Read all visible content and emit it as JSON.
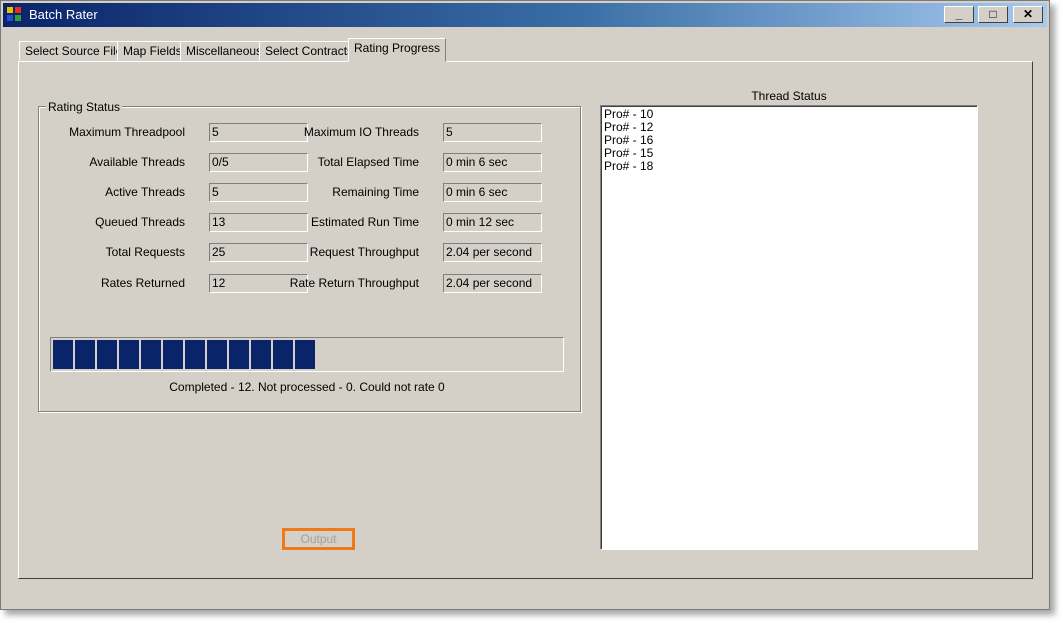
{
  "window": {
    "title": "Batch Rater",
    "minimize": "_",
    "maximize": "□",
    "close": "✕"
  },
  "tabs": [
    {
      "label": "Select Source File"
    },
    {
      "label": "Map Fields"
    },
    {
      "label": "Miscellaneous"
    },
    {
      "label": "Select Contracts"
    },
    {
      "label": "Rating Progress"
    }
  ],
  "active_tab": "Rating Progress",
  "rating_status": {
    "title": "Rating Status",
    "left": [
      {
        "label": "Maximum Threadpool",
        "value": "5"
      },
      {
        "label": "Available Threads",
        "value": "0/5"
      },
      {
        "label": "Active Threads",
        "value": "5"
      },
      {
        "label": "Queued Threads",
        "value": "13"
      },
      {
        "label": "Total Requests",
        "value": "25"
      },
      {
        "label": "Rates Returned",
        "value": "12"
      }
    ],
    "right": [
      {
        "label": "Maximum IO Threads",
        "value": "5"
      },
      {
        "label": "Total Elapsed Time",
        "value": "0 min 6 sec"
      },
      {
        "label": "Remaining Time",
        "value": "0 min 6 sec"
      },
      {
        "label": "Estimated Run Time",
        "value": "0 min 12 sec"
      },
      {
        "label": "Request Throughput",
        "value": "2.04 per second"
      },
      {
        "label": "Rate Return Throughput",
        "value": "2.04 per second"
      }
    ],
    "progress_fraction": 0.5,
    "progress_text": "Completed - 12.   Not processed - 0.   Could not rate 0"
  },
  "thread_status": {
    "title": "Thread Status",
    "items": [
      "Pro# - 10",
      "Pro# - 12",
      "Pro# - 16",
      "Pro# - 15",
      "Pro# - 18"
    ]
  },
  "output_button": {
    "label": "Output",
    "enabled": false,
    "highlight_color": "#f07818"
  },
  "colors": {
    "titlebar_start": "#0a246a",
    "titlebar_end": "#a6caf0",
    "face": "#d4d0c8",
    "progress": "#0a246a"
  }
}
